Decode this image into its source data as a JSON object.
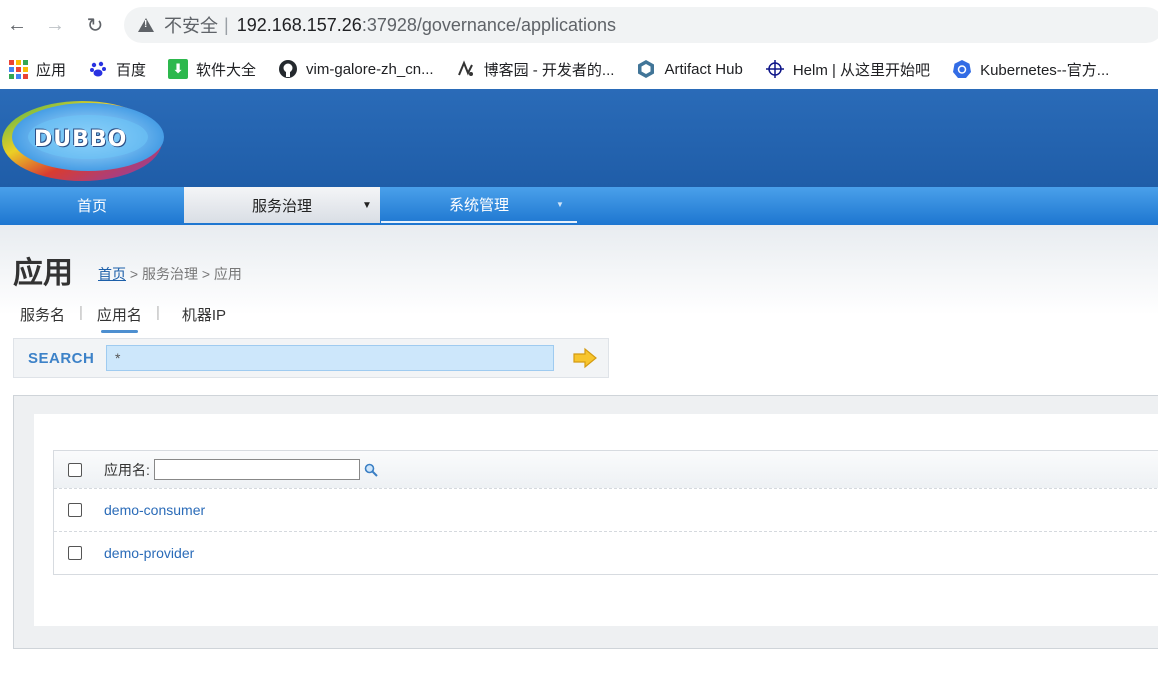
{
  "browser": {
    "insecure_label": "不安全",
    "separator": "|",
    "url_host": "192.168.157.26",
    "url_path": ":37928/governance/applications",
    "bookmarks": [
      {
        "label": "应用",
        "icon": "apps-grid-icon"
      },
      {
        "label": "百度",
        "icon": "baidu-paw-icon"
      },
      {
        "label": "软件大全",
        "icon": "download-icon"
      },
      {
        "label": "vim-galore-zh_cn...",
        "icon": "github-icon"
      },
      {
        "label": "博客园 - 开发者的...",
        "icon": "cnblogs-icon"
      },
      {
        "label": "Artifact Hub",
        "icon": "hexagon-icon"
      },
      {
        "label": "Helm | 从这里开始吧",
        "icon": "helm-wheel-icon"
      },
      {
        "label": "Kubernetes--官方...",
        "icon": "kubernetes-icon"
      }
    ]
  },
  "header": {
    "logo_text": "DUBBO"
  },
  "menu": {
    "home": "首页",
    "governance": "服务治理",
    "system": "系统管理"
  },
  "page": {
    "title": "应用",
    "breadcrumb_home": "首页",
    "breadcrumb_rest": " > 服务治理 > 应用"
  },
  "tabs": {
    "service": "服务名",
    "application": "应用名",
    "machine": "机器IP",
    "sep": "|"
  },
  "search": {
    "label": "SEARCH",
    "value": "*"
  },
  "table": {
    "header_label": "应用名:",
    "rows": [
      "demo-consumer",
      "demo-provider"
    ]
  },
  "colors": {
    "header_blue": "#1f5da8",
    "menu_blue": "#1d76d0",
    "link_blue": "#2a6bb8"
  }
}
